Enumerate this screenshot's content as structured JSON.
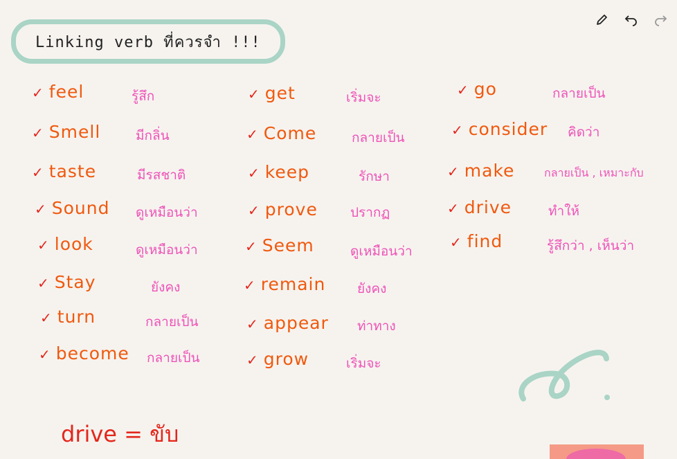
{
  "title": "Linking verb ที่ควรจำ !!!",
  "toolbar": {
    "tools": [
      "pencil-icon",
      "undo-icon",
      "redo-icon"
    ]
  },
  "columns": [
    [
      {
        "en": "feel",
        "th": "รู้สึก"
      },
      {
        "en": "Smell",
        "th": "มีกลิ่น"
      },
      {
        "en": "taste",
        "th": "มีรสชาติ"
      },
      {
        "en": "Sound",
        "th": "ดูเหมือนว่า"
      },
      {
        "en": "look",
        "th": "ดูเหมือนว่า"
      },
      {
        "en": "Stay",
        "th": "ยังคง"
      },
      {
        "en": "turn",
        "th": "กลายเป็น"
      },
      {
        "en": "become",
        "th": "กลายเป็น"
      }
    ],
    [
      {
        "en": "get",
        "th": "เริ่มจะ"
      },
      {
        "en": "Come",
        "th": "กลายเป็น"
      },
      {
        "en": "keep",
        "th": "รักษา"
      },
      {
        "en": "prove",
        "th": "ปรากฏ"
      },
      {
        "en": "Seem",
        "th": "ดูเหมือนว่า"
      },
      {
        "en": "remain",
        "th": "ยังคง"
      },
      {
        "en": "appear",
        "th": "ท่าทาง"
      },
      {
        "en": "grow",
        "th": "เริ่มจะ"
      }
    ],
    [
      {
        "en": "go",
        "th": "กลายเป็น"
      },
      {
        "en": "consider",
        "th": "คิดว่า"
      },
      {
        "en": "make",
        "th": "กลายเป็น , เหมาะกับ"
      },
      {
        "en": "drive",
        "th": "ทำให้"
      },
      {
        "en": "find",
        "th": "รู้สึกว่า , เห็นว่า"
      }
    ]
  ],
  "check_mark": "✓",
  "note": "drive = ขับ",
  "colors": {
    "accent_green": "#a9d4c6",
    "orange": "#f0590e",
    "pink": "#ee52b7",
    "red": "#e4261b"
  }
}
